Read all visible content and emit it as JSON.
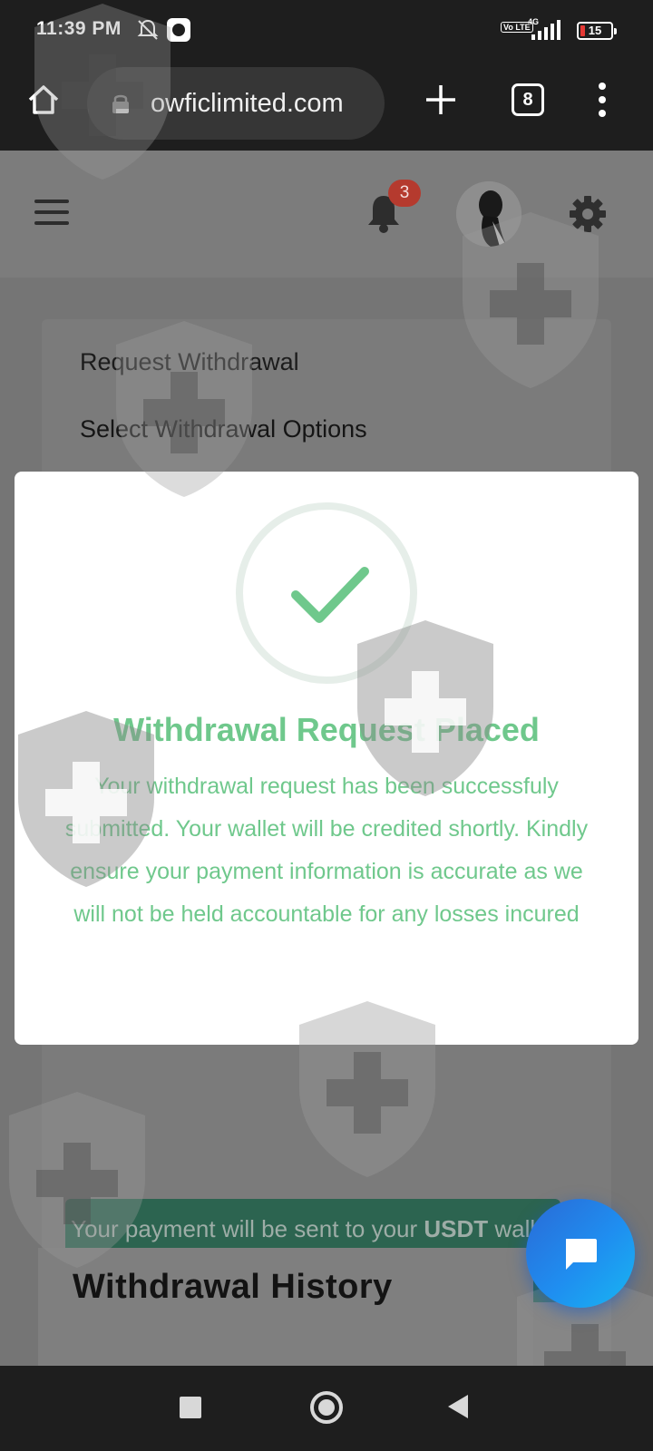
{
  "status_bar": {
    "time": "11:39 PM",
    "network_label": "Vo LTE",
    "signal_label": "4G",
    "battery": "15"
  },
  "browser": {
    "url": "owficlimited.com",
    "tab_count": "8"
  },
  "header": {
    "notification_count": "3"
  },
  "card": {
    "title": "Request Withdrawal",
    "subtitle": "Select Withdrawal Options"
  },
  "notice": {
    "text_before": "Your payment will be sent to your ",
    "currency": "USDT",
    "text_after": " wallet address."
  },
  "history": {
    "title": "Withdrawal History"
  },
  "dialog": {
    "title": "Withdrawal Request Placed",
    "message": "Your withdrawal request has been successfuly submitted. Your wallet will be credited shortly. Kindly ensure your payment information is accurate as we will not be held accountable for any losses incured"
  },
  "colors": {
    "success": "#6fc88c",
    "notice_bg": "#2c6450",
    "badge": "#b53a2e",
    "fab": "#1f8ef0"
  },
  "icons": {
    "status": [
      "mute-icon",
      "app-notification-icon",
      "signal-icon",
      "battery-icon"
    ],
    "browser": [
      "home-icon",
      "lock-icon",
      "plus-icon",
      "tabs-icon",
      "more-vert-icon"
    ],
    "header": [
      "menu-icon",
      "bell-icon",
      "avatar",
      "gear-icon"
    ],
    "dialog": [
      "checkmark-icon"
    ],
    "fab": [
      "chat-icon"
    ],
    "nav": [
      "recents-icon",
      "home-circle-icon",
      "back-icon"
    ]
  }
}
